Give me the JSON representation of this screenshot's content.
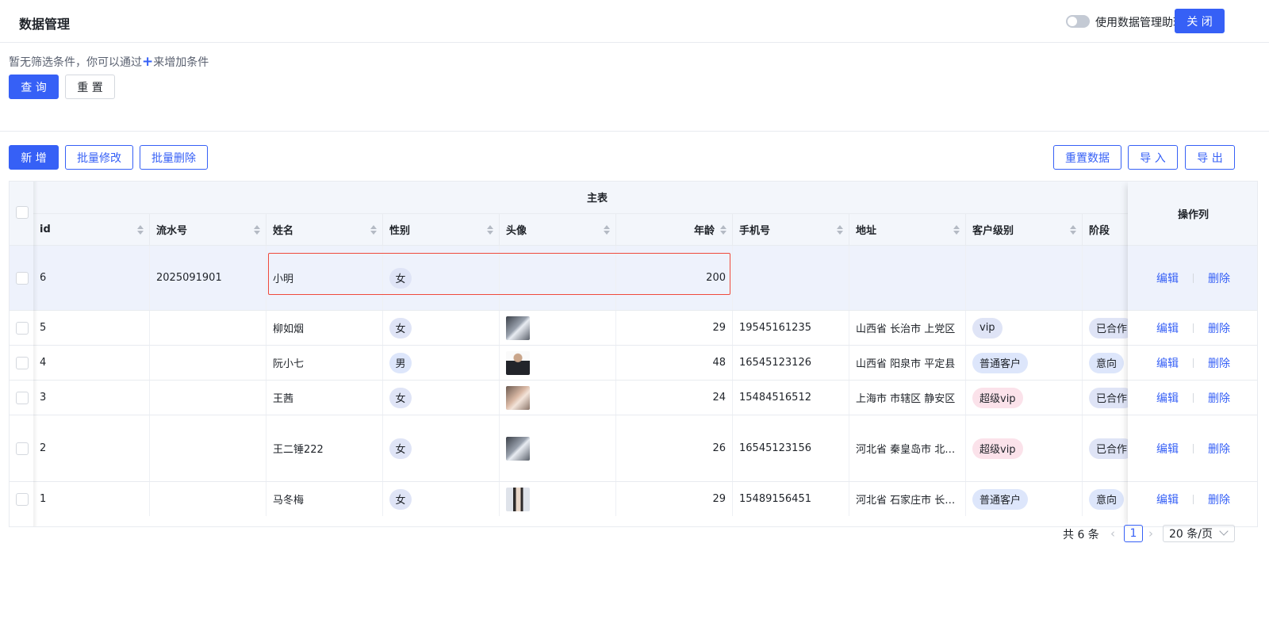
{
  "header": {
    "title": "数据管理",
    "assistant_label": "使用数据管理助理",
    "close_label": "关 闭"
  },
  "filter": {
    "hint_before": "暂无筛选条件，你可以通过",
    "hint_plus": "+",
    "hint_after": "来增加条件",
    "query_label": "查 询",
    "reset_label": "重 置"
  },
  "toolbar": {
    "add_label": "新 增",
    "batch_edit_label": "批量修改",
    "batch_delete_label": "批量删除",
    "reset_data_label": "重置数据",
    "import_label": "导 入",
    "export_label": "导 出"
  },
  "table": {
    "group_title": "主表",
    "op_title": "操作列",
    "columns": [
      "id",
      "流水号",
      "姓名",
      "性别",
      "头像",
      "年龄",
      "手机号",
      "地址",
      "客户级别",
      "阶段"
    ],
    "edit_label": "编辑",
    "delete_label": "删除",
    "rows": [
      {
        "id": "6",
        "serial": "2025091901",
        "name": "小明",
        "gender": "女",
        "avatar": "",
        "age": "200",
        "phone": "",
        "address": "",
        "level": "",
        "stage": ""
      },
      {
        "id": "5",
        "serial": "",
        "name": "柳如烟",
        "gender": "女",
        "avatar": "avatar-photo-gray",
        "age": "29",
        "phone": "19545161235",
        "address": "山西省 长治市 上党区",
        "level": "vip",
        "stage": "已合作"
      },
      {
        "id": "4",
        "serial": "",
        "name": "阮小七",
        "gender": "男",
        "avatar": "avatar-photo-suit",
        "age": "48",
        "phone": "16545123126",
        "address": "山西省 阳泉市 平定县",
        "level": "普通客户",
        "stage": "意向"
      },
      {
        "id": "3",
        "serial": "",
        "name": "王茜",
        "gender": "女",
        "avatar": "avatar-photo-warm",
        "age": "24",
        "phone": "15484516512",
        "address": "上海市 市辖区 静安区",
        "level": "超级vip",
        "stage": "已合作"
      },
      {
        "id": "2",
        "serial": "",
        "name": "王二锤222",
        "gender": "女",
        "avatar": "avatar-photo-gray",
        "age": "26",
        "phone": "16545123156",
        "address": "河北省 秦皇岛市 北…",
        "level": "超级vip",
        "stage": "已合作"
      },
      {
        "id": "1",
        "serial": "",
        "name": "马冬梅",
        "gender": "女",
        "avatar": "avatar-photo-light",
        "age": "29",
        "phone": "15489156451",
        "address": "河北省 石家庄市 长…",
        "level": "普通客户",
        "stage": "意向"
      }
    ]
  },
  "pagination": {
    "total_label": "共 6 条",
    "current_page": "1",
    "page_size_label": "20 条/页"
  },
  "colors": {
    "primary": "#3660f6",
    "edit_highlight": "#ef4a3c",
    "tag_vip": "#dde6fb",
    "tag_super_vip": "#fbe2ea"
  }
}
